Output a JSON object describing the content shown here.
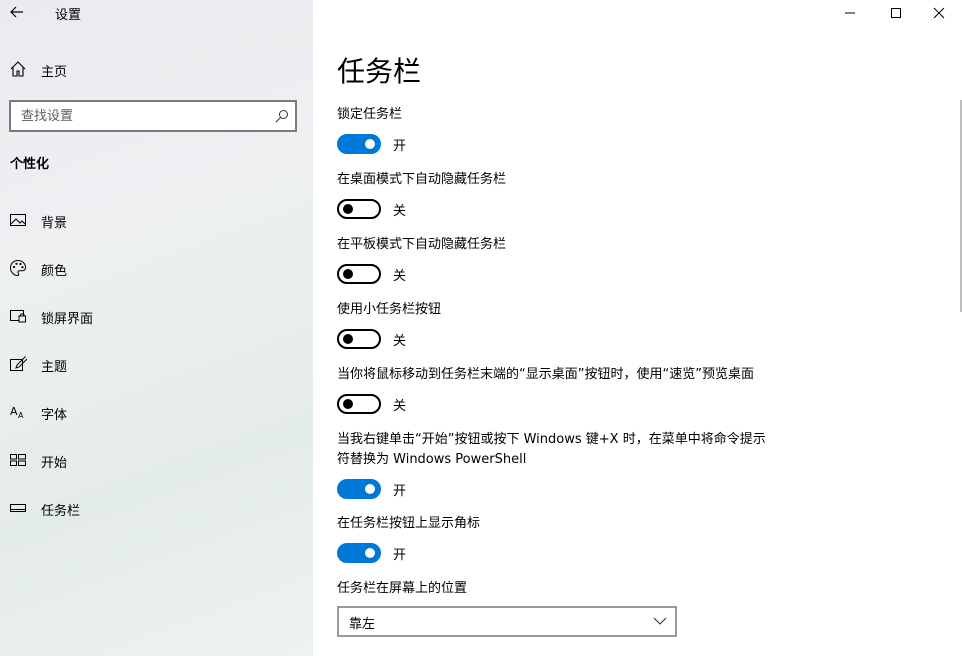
{
  "window": {
    "app_title": "设置",
    "controls": [
      "minimize",
      "maximize",
      "close"
    ]
  },
  "sidebar": {
    "home_label": "主页",
    "search_placeholder": "查找设置",
    "section_heading": "个性化",
    "items": [
      {
        "label": "背景",
        "icon": "picture-icon"
      },
      {
        "label": "颜色",
        "icon": "palette-icon"
      },
      {
        "label": "锁屏界面",
        "icon": "lock-screen-icon"
      },
      {
        "label": "主题",
        "icon": "theme-brush-icon"
      },
      {
        "label": "字体",
        "icon": "font-icon"
      },
      {
        "label": "开始",
        "icon": "start-grid-icon"
      },
      {
        "label": "任务栏",
        "icon": "taskbar-icon"
      }
    ]
  },
  "main": {
    "title": "任务栏",
    "settings": [
      {
        "label": "锁定任务栏",
        "on": true,
        "state": "开"
      },
      {
        "label": "在桌面模式下自动隐藏任务栏",
        "on": false,
        "state": "关"
      },
      {
        "label": "在平板模式下自动隐藏任务栏",
        "on": false,
        "state": "关"
      },
      {
        "label": "使用小任务栏按钮",
        "on": false,
        "state": "关"
      },
      {
        "label": "当你将鼠标移动到任务栏末端的“显示桌面”按钮时，使用“速览”预览桌面",
        "on": false,
        "state": "关"
      },
      {
        "label": "当我右键单击“开始”按钮或按下 Windows 键+X 时，在菜单中将命令提示符替换为 Windows PowerShell",
        "on": true,
        "state": "开"
      },
      {
        "label": "在任务栏按钮上显示角标",
        "on": true,
        "state": "开"
      }
    ],
    "position_label": "任务栏在屏幕上的位置",
    "position_value": "靠左"
  },
  "colors": {
    "accent": "#0078d7"
  }
}
